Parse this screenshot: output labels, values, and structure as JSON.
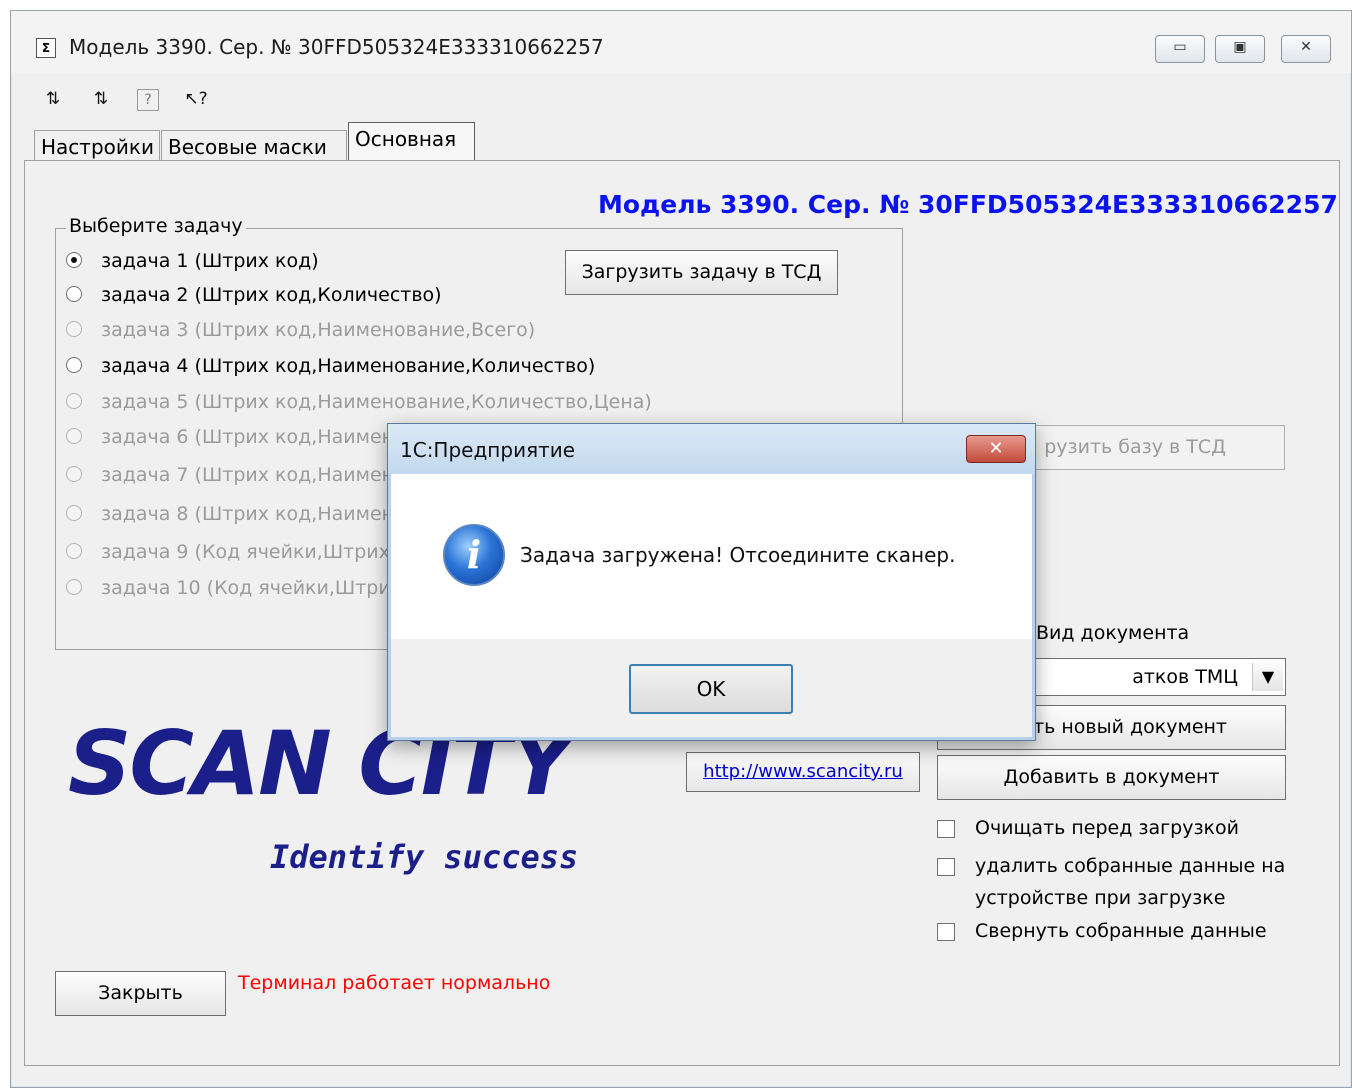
{
  "window": {
    "title": "Модель 3390. Сер. № 30FFD505324E333310662257",
    "app_icon": "Σ",
    "caption_buttons": {
      "minimize": "▭",
      "maximize": "▣",
      "close": "✕"
    },
    "toolbar": [
      "⇅",
      "⇅",
      "?",
      "↖?"
    ]
  },
  "tabs": [
    {
      "label": "Настройки"
    },
    {
      "label": "Весовые маски"
    },
    {
      "label": "Основная"
    }
  ],
  "main": {
    "model_header": "Модель 3390. Сер. № 30FFD505324E333310662257",
    "task_group_label": "Выберите задачу",
    "tasks": [
      {
        "label": "задача 1 (Штрих код)",
        "selected": true,
        "enabled": true
      },
      {
        "label": "задача 2 (Штрих код,Количество)",
        "selected": false,
        "enabled": true
      },
      {
        "label": "задача 3 (Штрих код,Наименование,Всего)",
        "selected": false,
        "enabled": false
      },
      {
        "label": "задача 4 (Штрих код,Наименование,Количество)",
        "selected": false,
        "enabled": true
      },
      {
        "label": "задача 5 (Штрих код,Наименование,Количество,Цена)",
        "selected": false,
        "enabled": false
      },
      {
        "label": "задача 6 (Штрих код,Наимен",
        "selected": false,
        "enabled": false
      },
      {
        "label": "задача 7 (Штрих код,Наимен",
        "selected": false,
        "enabled": false
      },
      {
        "label": "задача 8 (Штрих код,Наимен",
        "selected": false,
        "enabled": false
      },
      {
        "label": "задача 9 (Код ячейки,Штрих",
        "selected": false,
        "enabled": false
      },
      {
        "label": "задача 10 (Код ячейки,Штри",
        "selected": false,
        "enabled": false
      }
    ],
    "load_task_button": "Загрузить задачу в ТСД",
    "load_base_button": "рузить базу в ТСД",
    "doc_type_label": "Вид документа",
    "doc_type_value": "атков ТМЦ",
    "create_doc_button": "ать новый документ",
    "add_doc_button": "Добавить в документ",
    "site_link": "http://www.scancity.ru",
    "checkboxes": [
      {
        "label": "Очищать перед загрузкой",
        "checked": false
      },
      {
        "label": "удалить собранные данные на",
        "label2": "устройстве при загрузке",
        "checked": false
      },
      {
        "label": "Свернуть собранные данные",
        "checked": false
      }
    ],
    "logo_text": "SCAN CITY",
    "slogan": "Identify success",
    "close_button": "Закрыть",
    "status_text": "Терминал работает нормально",
    "status_color": "#ff0000"
  },
  "dialog": {
    "title": "1С:Предприятие",
    "close_glyph": "✕",
    "message": "Задача загружена! Отсоедините сканер.",
    "icon": "info-icon",
    "icon_glyph": "i",
    "ok_button": "OK"
  }
}
